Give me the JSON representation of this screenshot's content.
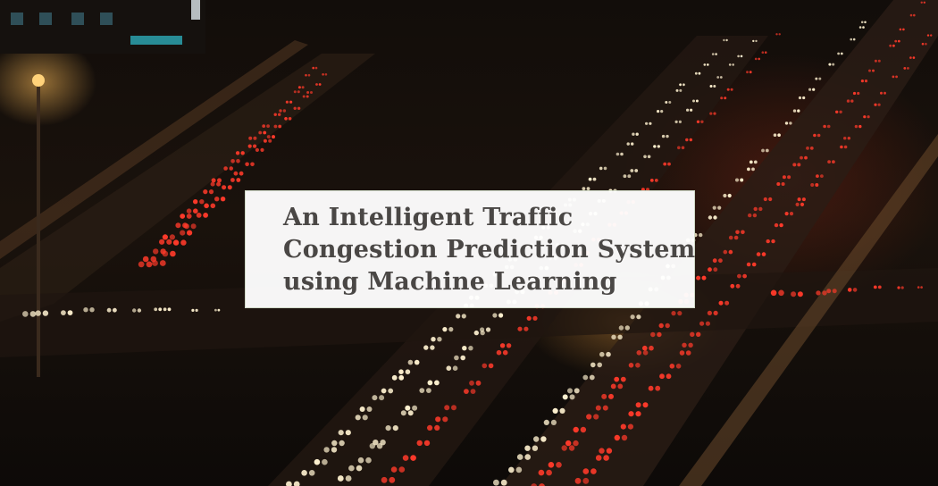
{
  "title": {
    "lines": [
      "An Intelligent Traffic",
      "Congestion Prediction System",
      "using Machine Learning"
    ]
  },
  "image": {
    "subject": "night-traffic-jam-photo",
    "palette": {
      "background": "#0b0806",
      "taillight": "#ff3a2a",
      "headlight": "#fff2d0",
      "streetlamp": "#ffc35a",
      "card": "#ffffff",
      "title_text": "#4a4745"
    }
  }
}
